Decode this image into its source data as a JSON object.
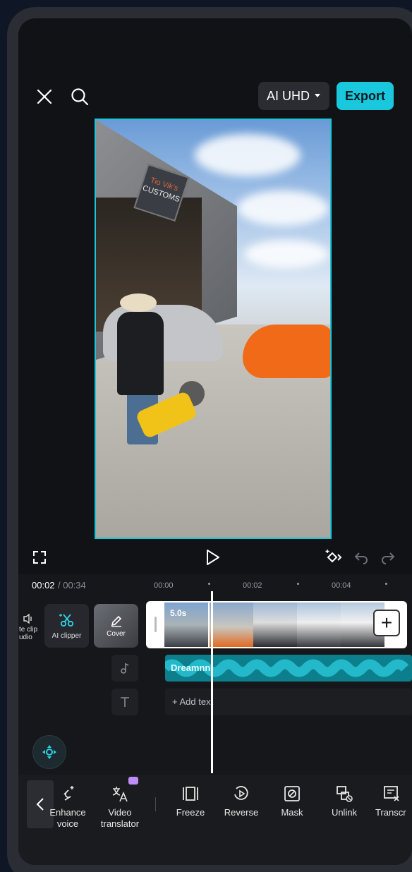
{
  "topbar": {
    "quality_label": "AI UHD",
    "export_label": "Export"
  },
  "preview": {
    "sign_line1": "Tio Vik's",
    "sign_line2": "CUSTOMS"
  },
  "timeline": {
    "current_time": "00:02",
    "total_time": "/ 00:34",
    "ruler": [
      "00:00",
      "00:02",
      "00:04"
    ],
    "clip_duration": "5.0s",
    "audio_name": "Dreamnn",
    "add_text_label": "+ Add text",
    "mute_label": "te clip\nudio",
    "ai_clipper_label": "AI clipper",
    "cover_label": "Cover",
    "add_clip_label": "+"
  },
  "toolbar": {
    "items": [
      {
        "label": "Enhance\nvoice",
        "icon": "enhance-voice-icon"
      },
      {
        "label": "Video\ntranslator",
        "icon": "translate-icon"
      },
      {
        "label": "Freeze",
        "icon": "freeze-icon"
      },
      {
        "label": "Reverse",
        "icon": "reverse-icon"
      },
      {
        "label": "Mask",
        "icon": "mask-icon"
      },
      {
        "label": "Unlink",
        "icon": "unlink-icon"
      },
      {
        "label": "Transcr",
        "icon": "transcribe-icon"
      }
    ]
  },
  "colors": {
    "accent": "#19c8dc",
    "audio_track": "#0d7f8c",
    "background": "#111216"
  }
}
